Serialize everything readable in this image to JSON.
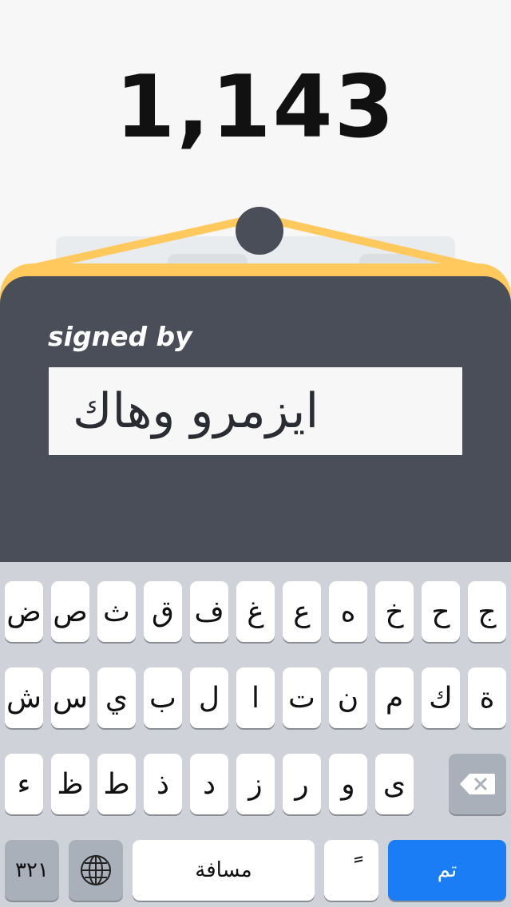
{
  "score": "1,143",
  "signature": {
    "label": "signed by",
    "name": "ايزمرو وهاك"
  },
  "keyboard": {
    "row1": [
      "ض",
      "ص",
      "ث",
      "ق",
      "ف",
      "غ",
      "ع",
      "ه",
      "خ",
      "ح",
      "ج"
    ],
    "row2": [
      "ش",
      "س",
      "ي",
      "ب",
      "ل",
      "ا",
      "ت",
      "ن",
      "م",
      "ك",
      "ة"
    ],
    "row3": [
      "ء",
      "ظ",
      "ط",
      "ذ",
      "د",
      "ز",
      "ر",
      "و",
      "ى"
    ],
    "numbers_key": "٣٢١",
    "space_key": "مسافة",
    "diacritic_key": "ً",
    "done_key": "تم"
  },
  "colors": {
    "board": "#4a4e59",
    "rim": "#ffc95e",
    "keyboard_bg": "#cfd3d9",
    "done_key": "#1a7df6"
  }
}
